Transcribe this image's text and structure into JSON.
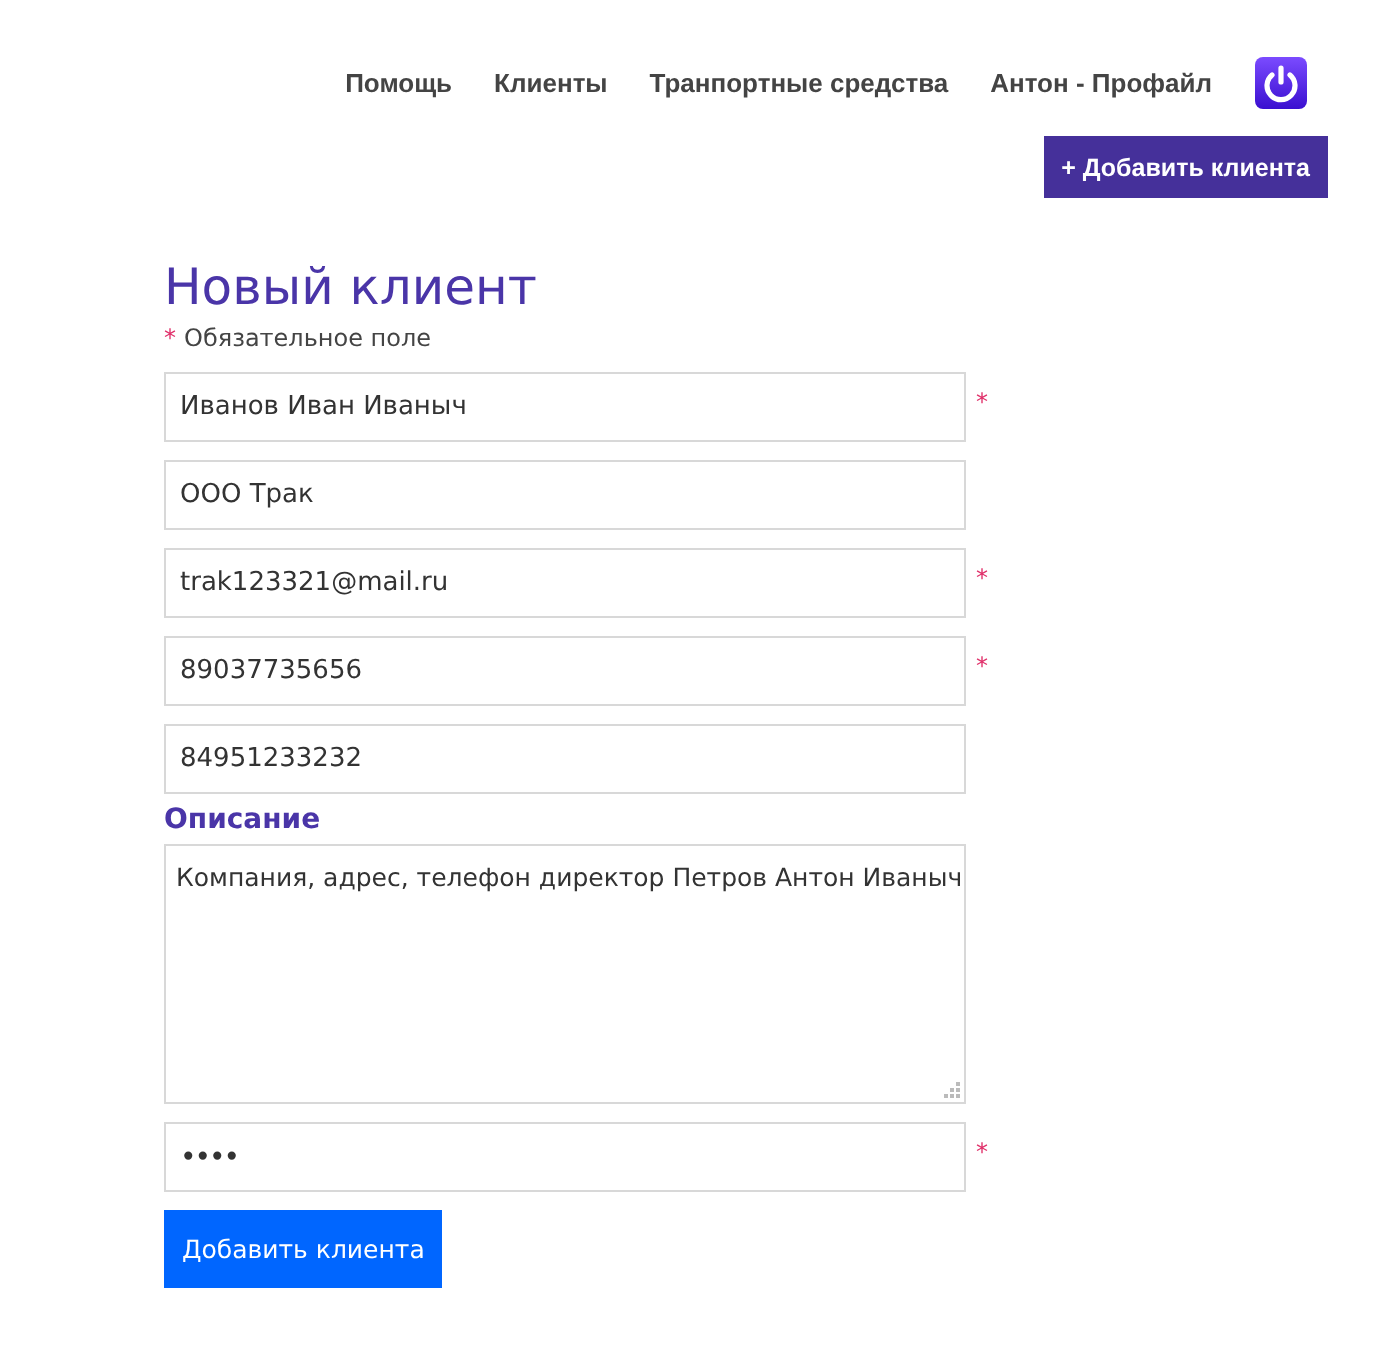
{
  "nav": {
    "items": [
      "Помощь",
      "Клиенты",
      "Транпортные средства",
      "Антон - Профайл"
    ]
  },
  "add_button": "+ Добавить клиента",
  "title": "Новый клиент",
  "required_note": {
    "mark": "*",
    "text": "Обязательное поле"
  },
  "fields": [
    {
      "kind": "input",
      "value": "Иванов Иван Иваныч",
      "required_mark": "*"
    },
    {
      "kind": "input",
      "value": "ООО Трак"
    },
    {
      "kind": "input",
      "value": "trak123321@mail.ru",
      "required_mark": "*"
    },
    {
      "kind": "input",
      "value": "89037735656",
      "required_mark": "*"
    },
    {
      "kind": "input",
      "value": "84951233232"
    },
    {
      "kind": "label",
      "text": "Описание"
    },
    {
      "kind": "textarea",
      "value": "Компания, адрес, телефон директор Петров Антон Иваныч"
    },
    {
      "kind": "password",
      "value": "••••",
      "required_mark": "*"
    }
  ],
  "submit": "Добавить клиента"
}
